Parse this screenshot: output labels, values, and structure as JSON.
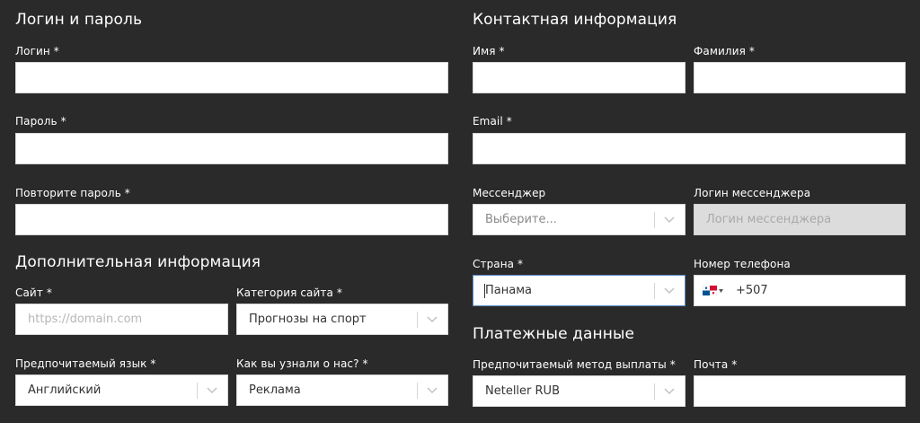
{
  "login_section": {
    "title": "Логин и пароль",
    "login_label": "Логин *",
    "password_label": "Пароль *",
    "repeat_password_label": "Повторите пароль *"
  },
  "contact_section": {
    "title": "Контактная информация",
    "name_label": "Имя *",
    "surname_label": "Фамилия *",
    "email_label": "Email *",
    "messenger_label": "Мессенджер",
    "messenger_value": "Выберите...",
    "messenger_login_label": "Логин мессенджера",
    "messenger_login_placeholder": "Логин мессенджера",
    "country_label": "Страна *",
    "country_value": "Панама",
    "phone_label": "Номер телефона",
    "phone_code": "+507"
  },
  "additional_section": {
    "title": "Дополнительная информация",
    "site_label": "Сайт *",
    "site_placeholder": "https://domain.com",
    "category_label": "Категория сайта *",
    "category_value": "Прогнозы на спорт",
    "language_label": "Предпочитаемый язык *",
    "language_value": "Английский",
    "source_label": "Как вы узнали о нас? *",
    "source_value": "Реклама"
  },
  "payment_section": {
    "title": "Платежные данные",
    "method_label": "Предпочитаемый метод выплаты *",
    "method_value": "Neteller RUB",
    "mail_label": "Почта *"
  },
  "colors": {
    "background": "#2b2a2a",
    "field": "#ffffff",
    "disabled_field": "#dcdcdc",
    "focus_border": "#5b8cc8"
  }
}
